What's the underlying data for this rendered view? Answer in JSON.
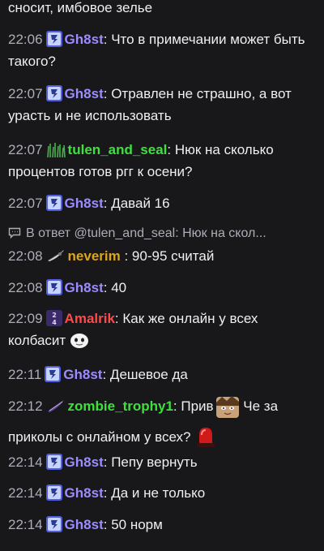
{
  "messages": [
    {
      "continuation": "сносит, имбовое зелье"
    },
    {
      "time": "22:06",
      "user": "Gh8st",
      "color": "#9b8cff",
      "sep": ":",
      "text": " Что в примечании может быть такого?"
    },
    {
      "time": "22:07",
      "user": "Gh8st",
      "color": "#9b8cff",
      "sep": ":",
      "text": " Отравлен не страшно, а вот урасть и не использовать"
    },
    {
      "time": "22:07",
      "user": "tulen_and_seal",
      "color": "#3ee03e",
      "sep": ":",
      "text": " Нюк на сколько процентов готов ргг к осени?"
    },
    {
      "time": "22:07",
      "user": "Gh8st",
      "color": "#9b8cff",
      "sep": ":",
      "text": " Давай 16"
    },
    {
      "reply": "В ответ @tulen_and_seal: Нюк на скол..."
    },
    {
      "time": "22:08",
      "user": "neverim",
      "color": "#daa520",
      "sep": " :",
      "text": " 90-95 считай"
    },
    {
      "time": "22:08",
      "user": "Gh8st",
      "color": "#9b8cff",
      "sep": ":",
      "text": " 40"
    },
    {
      "time": "22:09",
      "user": "Amalrik",
      "color": "#ff4a4a",
      "sep": ":",
      "text": " Как же онлайн у всех колбасит"
    },
    {
      "time": "22:11",
      "user": "Gh8st",
      "color": "#9b8cff",
      "sep": ":",
      "text": " Дешевое да"
    },
    {
      "time": "22:12",
      "user": "zombie_trophy1",
      "color": "#3ee03e",
      "sep": ":",
      "text_a": " Прив",
      "text_b": " Че за приколы с онлайном у всех?"
    },
    {
      "time": "22:14",
      "user": "Gh8st",
      "color": "#9b8cff",
      "sep": ":",
      "text": " Пепу вернуть"
    },
    {
      "time": "22:14",
      "user": "Gh8st",
      "color": "#9b8cff",
      "sep": ":",
      "text": " Да и не только"
    },
    {
      "time": "22:14",
      "user": "Gh8st",
      "color": "#9b8cff",
      "sep": ":",
      "text": " 50 норм"
    }
  ],
  "icons": {
    "gh8st_badge": "subscriber-badge-icon",
    "tulen_badge": "grass-badge-icon",
    "neverim_badge": "feather-badge-icon",
    "amalrik_badge": "24-badge-icon",
    "zombie_badge": "feather-badge-icon",
    "reply": "chat-bubble-icon"
  }
}
